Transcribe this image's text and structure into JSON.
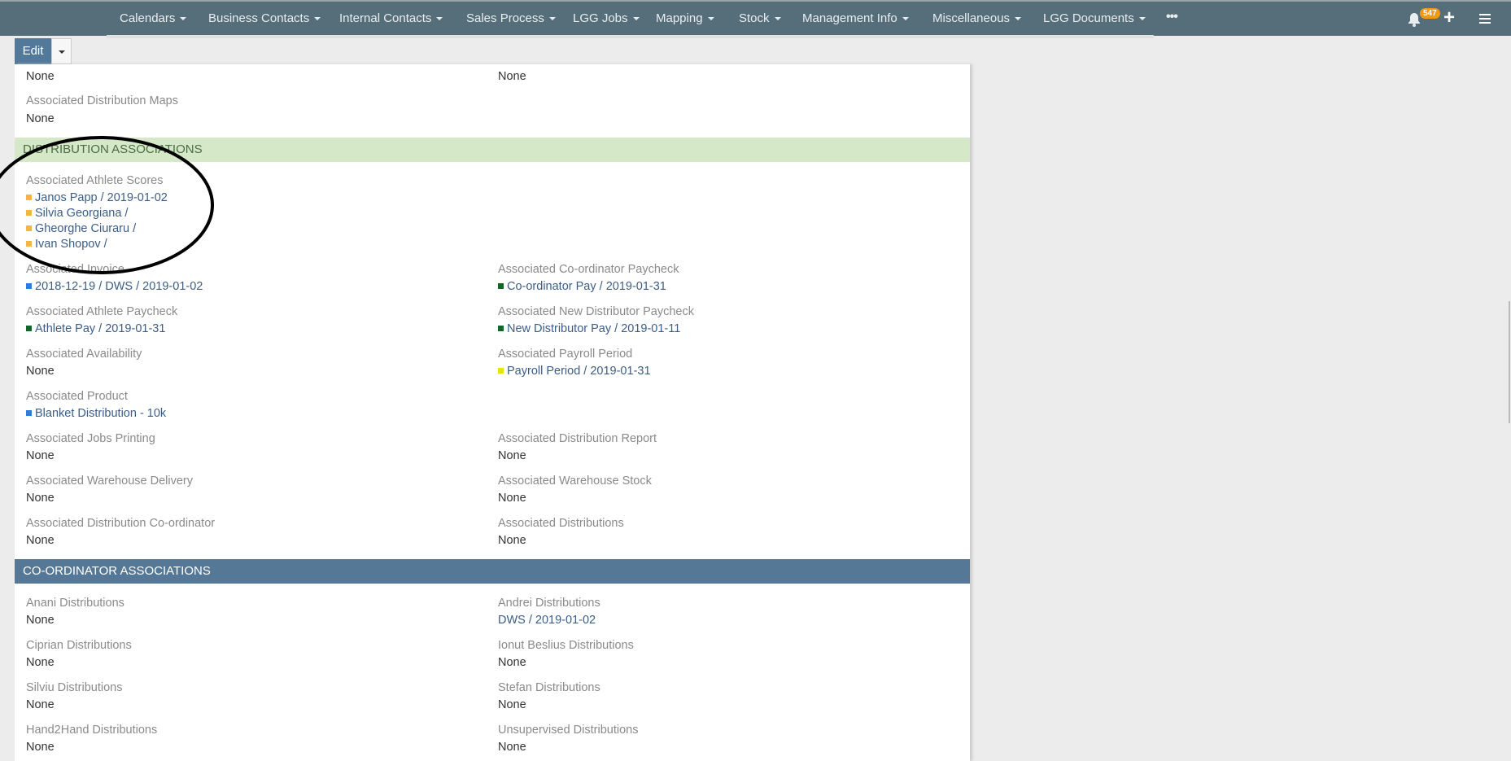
{
  "nav": {
    "items": [
      "Calendars",
      "Business Contacts",
      "Internal Contacts",
      "Sales Process",
      "LGG Jobs",
      "Mapping",
      "Stock",
      "Management Info",
      "Miscellaneous",
      "LGG Documents"
    ],
    "more": "•••",
    "notification_count": "547"
  },
  "toolbar": {
    "edit_label": "Edit"
  },
  "top": {
    "left_value": "None",
    "right_value": "None",
    "maps_label": "Associated Distribution Maps",
    "maps_value": "None"
  },
  "dist_section": {
    "title": "DISTRIBUTION ASSOCIATIONS",
    "athlete_scores_label": "Associated Athlete Scores",
    "athlete_scores": [
      "Janos Papp / 2019-01-02",
      "Silvia Georgiana /",
      "Gheorghe Ciuraru /",
      "Ivan Shopov /"
    ],
    "fields": [
      {
        "label": "Associated Invoice",
        "value": "2018-12-19 / DWS / 2019-01-02",
        "color": "#2d7de0"
      },
      {
        "label": "Associated Co-ordinator Paycheck",
        "value": "Co-ordinator Pay / 2019-01-31",
        "color": "#14652a"
      },
      {
        "label": "Associated Athlete Paycheck",
        "value": "Athlete Pay / 2019-01-31",
        "color": "#14652a"
      },
      {
        "label": "Associated New Distributor Paycheck",
        "value": "New Distributor Pay / 2019-01-11",
        "color": "#14652a"
      },
      {
        "label": "Associated Availability",
        "value": "None"
      },
      {
        "label": "Associated Payroll Period",
        "value": "Payroll Period / 2019-01-31",
        "color": "#e6e21c"
      },
      {
        "label": "Associated Product",
        "value": "Blanket Distribution - 10k",
        "color": "#2d7de0"
      },
      {
        "label": "Associated Jobs Printing",
        "value": "None"
      },
      {
        "label": "Associated Distribution Report",
        "value": "None"
      },
      {
        "label": "Associated Warehouse Delivery",
        "value": "None"
      },
      {
        "label": "Associated Warehouse Stock",
        "value": "None"
      },
      {
        "label": "Associated Distribution Co-ordinator",
        "value": "None"
      },
      {
        "label": "Associated Distributions",
        "value": "None"
      }
    ]
  },
  "coord_section": {
    "title": "CO-ORDINATOR ASSOCIATIONS",
    "fields": [
      {
        "label": "Anani Distributions",
        "value": "None"
      },
      {
        "label": "Andrei Distributions",
        "value": "DWS / 2019-01-02",
        "link": true
      },
      {
        "label": "Ciprian Distributions",
        "value": "None"
      },
      {
        "label": "Ionut Beslius Distributions",
        "value": "None"
      },
      {
        "label": "Silviu Distributions",
        "value": "None"
      },
      {
        "label": "Stefan Distributions",
        "value": "None"
      },
      {
        "label": "Hand2Hand Distributions",
        "value": "None"
      },
      {
        "label": "Unsupervised Distributions",
        "value": "None"
      }
    ]
  },
  "colors": {
    "nav": "#566e7a",
    "accent": "#52799a",
    "score_marker": "#f4b63f"
  }
}
